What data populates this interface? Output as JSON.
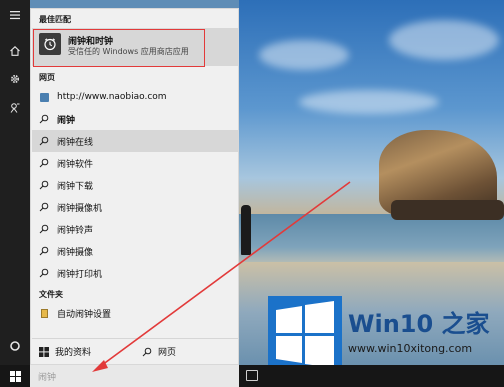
{
  "rail": {
    "items": [
      {
        "name": "hamburger-menu-icon"
      },
      {
        "name": "home-icon"
      },
      {
        "name": "settings-icon"
      },
      {
        "name": "feedback-icon"
      },
      {
        "name": "cortana-icon"
      }
    ]
  },
  "panel": {
    "best_match_header": "最佳匹配",
    "best_match": {
      "title": "闹钟和时钟",
      "subtitle": "受信任的 Windows 应用商店应用"
    },
    "web_header": "网页",
    "web_results": [
      {
        "text": "http://www.naobiao.com",
        "icon": "web-icon"
      },
      {
        "text": "闹钟",
        "icon": "search-icon"
      },
      {
        "text": "闹钟在线",
        "icon": "search-icon"
      },
      {
        "text": "闹钟软件",
        "icon": "search-icon"
      },
      {
        "text": "闹钟下载",
        "icon": "search-icon"
      },
      {
        "text": "闹钟摄像机",
        "icon": "search-icon"
      },
      {
        "text": "闹钟铃声",
        "icon": "search-icon"
      },
      {
        "text": "闹钟摄像",
        "icon": "search-icon"
      },
      {
        "text": "闹钟打印机",
        "icon": "search-icon"
      }
    ],
    "folder_header": "文件夹",
    "folder_results": [
      {
        "text": "自动闹钟设置",
        "icon": "folder-icon"
      }
    ],
    "bottom_tabs": {
      "my_stuff": "我的资料",
      "web": "网页"
    }
  },
  "taskbar": {
    "search_text": "闹钟"
  },
  "watermark": {
    "title": "Win10 之家",
    "url": "www.win10xitong.com"
  },
  "colors": {
    "highlight": "#d7d7d7",
    "annotation": "#e23a3a",
    "brand_blue": "#1a4e8f"
  }
}
